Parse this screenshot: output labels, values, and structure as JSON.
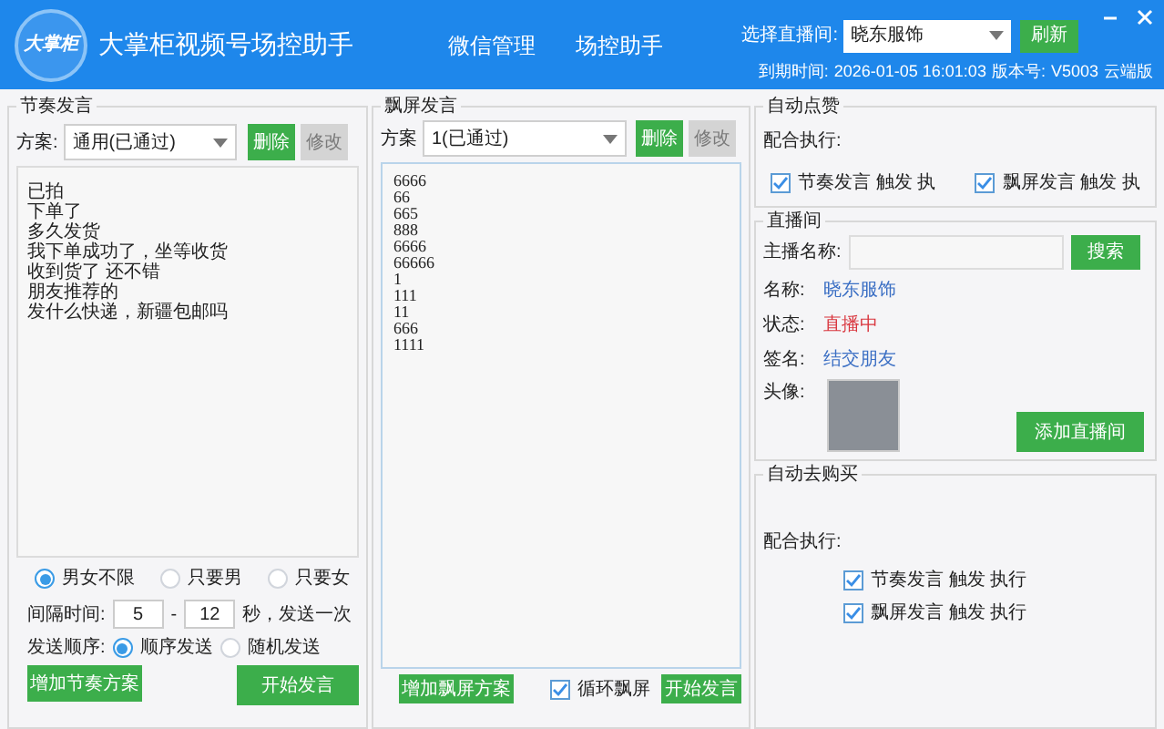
{
  "window": {
    "title": "大掌柜视频号场控助手",
    "logo_text": "大掌柜"
  },
  "nav": [
    {
      "label": "微信管理"
    },
    {
      "label": "场控助手"
    }
  ],
  "room_select": {
    "label": "选择直播间:",
    "value": "晓东服饰"
  },
  "refresh_button": "刷新",
  "expiry": {
    "label": "到期时间:",
    "value": "2026-01-05 16:01:03"
  },
  "version": {
    "label": "版本号:",
    "value": "V5003"
  },
  "edition": "云端版",
  "rhythm": {
    "title": "节奏发言",
    "scheme_label": "方案:",
    "scheme": "通用(已通过)",
    "delete_button": "删除",
    "edit_button": {
      "label": "修改",
      "disabled": true
    },
    "lines": [
      "已拍",
      "下单了",
      "多久发货",
      "我下单成功了，坐等收货",
      "收到货了 还不错",
      "朋友推荐的",
      "发什么快递，新疆包邮吗"
    ],
    "gender_options": [
      {
        "label": "男女不限",
        "selected": true
      },
      {
        "label": "只要男",
        "selected": false
      },
      {
        "label": "只要女",
        "selected": false
      }
    ],
    "interval": {
      "label": "间隔时间:",
      "min": "5",
      "dash": "-",
      "max": "12",
      "suffix": "秒，发送一次"
    },
    "order": {
      "label": "发送顺序:",
      "options": [
        {
          "label": "顺序发送",
          "selected": true
        },
        {
          "label": "随机发送",
          "selected": false
        }
      ]
    },
    "add_button": "增加节奏方案",
    "start_button": "开始发言"
  },
  "barrage": {
    "title": "飘屏发言",
    "scheme_label": "方案",
    "scheme": "1(已通过)",
    "delete_button": "删除",
    "edit_button": {
      "label": "修改",
      "disabled": true
    },
    "lines": [
      "6666",
      "66",
      "665",
      "888",
      "6666",
      "66666",
      "1",
      "111",
      "11",
      "666",
      "1111"
    ],
    "add_button": "增加飘屏方案",
    "loop": {
      "label": "循环飘屏",
      "checked": true
    },
    "start_button": "开始发言"
  },
  "auto_like": {
    "title": "自动点赞",
    "label": "配合执行:",
    "checks": [
      {
        "label": "节奏发言 触发 执",
        "checked": true
      },
      {
        "label": "飘屏发言 触发 执",
        "checked": true
      }
    ]
  },
  "live_room": {
    "title": "直播间",
    "anchor_label": "主播名称:",
    "search_button": "搜索",
    "info": [
      {
        "label": "名称:",
        "value": "晓东服饰",
        "color": "#3b6fc4"
      },
      {
        "label": "状态:",
        "value": "直播中",
        "color": "#d9363e"
      },
      {
        "label": "签名:",
        "value": "结交朋友",
        "color": "#3b6fc4"
      }
    ],
    "avatar_label": "头像:",
    "add_button": "添加直播间"
  },
  "auto_buy": {
    "title": "自动去购买",
    "label": "配合执行:",
    "checks": [
      {
        "label": "节奏发言 触发 执行",
        "checked": true
      },
      {
        "label": "飘屏发言 触发 执行",
        "checked": true
      }
    ]
  }
}
